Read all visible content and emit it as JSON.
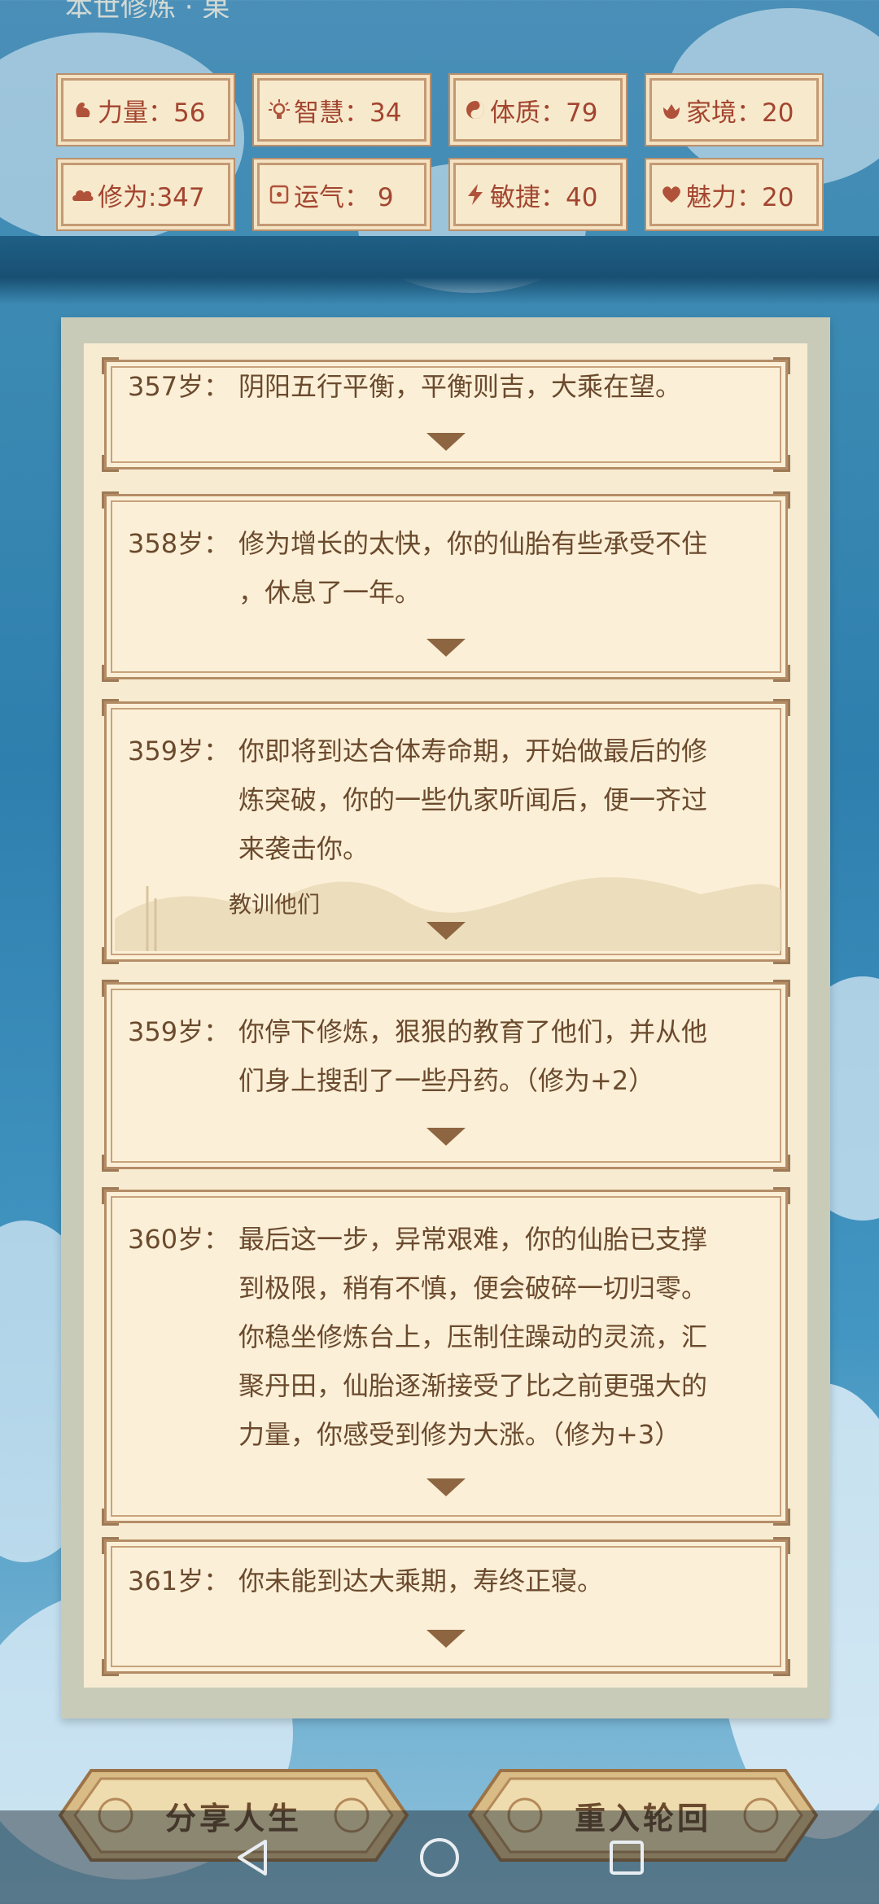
{
  "header": {
    "partial_text": "本世修炼 ‧ 果"
  },
  "stats": [
    {
      "icon": "strength-icon",
      "label": "力量：56"
    },
    {
      "icon": "wisdom-icon",
      "label": "智慧：34"
    },
    {
      "icon": "constitution-icon",
      "label": "体质：79"
    },
    {
      "icon": "family-icon",
      "label": "家境：20"
    },
    {
      "icon": "cultivation-icon",
      "label": "修为:347"
    },
    {
      "icon": "luck-icon",
      "label": "运气： 9"
    },
    {
      "icon": "agility-icon",
      "label": "敏捷：40"
    },
    {
      "icon": "charm-icon",
      "label": "魅力：20"
    }
  ],
  "events": [
    {
      "age": "357岁：",
      "lines": [
        "阴阳五行平衡，平衡则吉，大乘在望。"
      ]
    },
    {
      "age": "358岁：",
      "lines": [
        "修为增长的太快，你的仙胎有些承受不住",
        "，休息了一年。"
      ]
    },
    {
      "age": "359岁：",
      "lines": [
        "你即将到达合体寿命期，开始做最后的修",
        "炼突破，你的一些仇家听闻后，便一齐过",
        "来袭击你。"
      ],
      "choice": "教训他们"
    },
    {
      "age": "359岁：",
      "lines": [
        "你停下修炼，狠狠的教育了他们，并从他",
        "们身上搜刮了一些丹药。（修为+2）"
      ]
    },
    {
      "age": "360岁：",
      "lines": [
        "最后这一步，异常艰难，你的仙胎已支撑",
        "到极限，稍有不慎，便会破碎一切归零。",
        "你稳坐修炼台上，压制住躁动的灵流，汇",
        "聚丹田，仙胎逐渐接受了比之前更强大的",
        "力量，你感受到修为大涨。（修为+3）"
      ]
    },
    {
      "age": "361岁：",
      "lines": [
        "你未能到达大乘期，寿终正寝。"
      ]
    }
  ],
  "buttons": {
    "share": "分享人生",
    "restart": "重入轮回"
  },
  "nav": {
    "back": "back-icon",
    "home": "home-icon",
    "recents": "recents-icon"
  }
}
